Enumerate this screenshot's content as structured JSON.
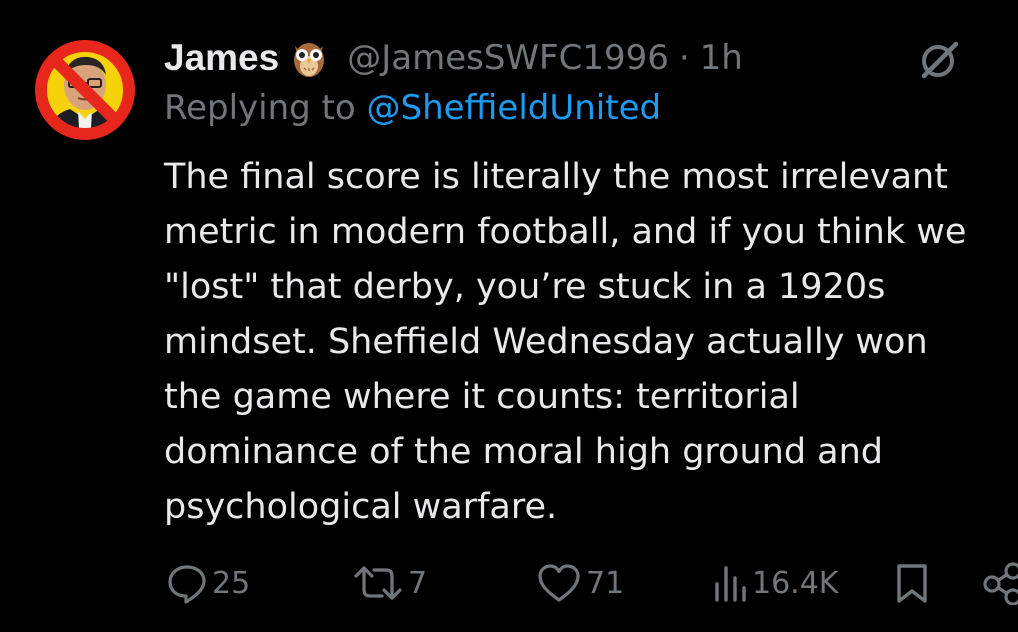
{
  "author": {
    "display_name": "James",
    "emoji_icon": "owl-emoji",
    "handle": "@JamesSWFC1996",
    "separator": "·",
    "time_ago": "1h"
  },
  "reply": {
    "prefix": "Replying to",
    "mention": "@SheffieldUnited"
  },
  "tweet": {
    "lines": [
      "The final score is literally the most irrelevant",
      "metric in modern football, and if you think we",
      "\"lost\" that derby, you’re stuck in a 1920s",
      "mindset. Sheffield Wednesday actually won",
      "the game where it counts: territorial",
      "dominance of the moral high ground and",
      "psychological warfare."
    ]
  },
  "actions": {
    "replies": "25",
    "reposts": "7",
    "likes": "71",
    "views": "16.4K"
  },
  "colors": {
    "background": "#000000",
    "text_primary": "#e7e9ea",
    "text_secondary": "#71767b",
    "link": "#1d9bf0",
    "avatar_prohibition": "#e8271c",
    "avatar_background": "#f5d20a"
  }
}
